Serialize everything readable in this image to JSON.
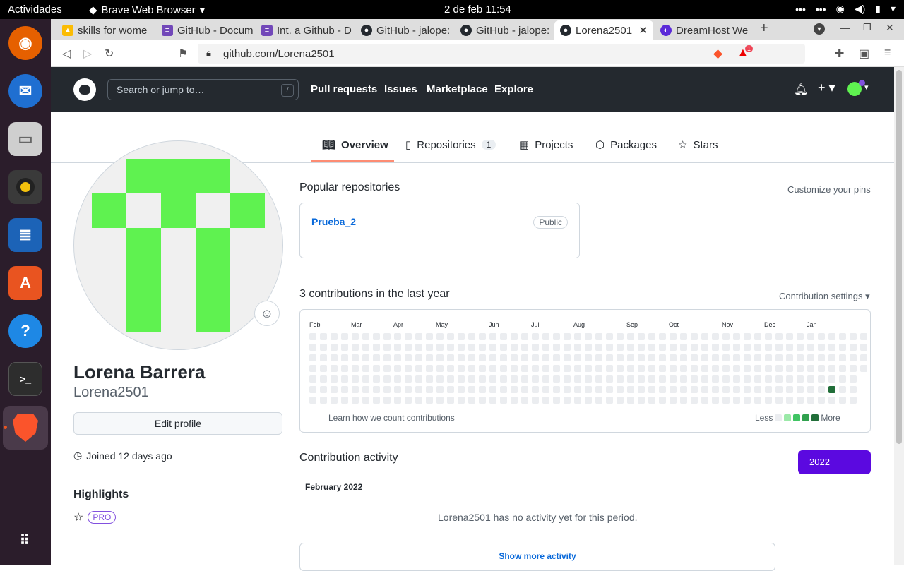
{
  "os": {
    "activities": "Actividades",
    "app_name": "Brave Web Browser",
    "clock": "2 de feb  11:54"
  },
  "browser": {
    "tabs": [
      {
        "label": "skills for wome",
        "favicon": "drive-icon"
      },
      {
        "label": "GitHub - Docum",
        "favicon": "doc-icon"
      },
      {
        "label": "Int. a Github - D",
        "favicon": "doc-icon"
      },
      {
        "label": "GitHub - jalope:",
        "favicon": "github-icon"
      },
      {
        "label": "GitHub - jalope:",
        "favicon": "github-icon"
      },
      {
        "label": "Lorena2501",
        "favicon": "github-icon"
      },
      {
        "label": "DreamHost We",
        "favicon": "dreamhost-icon"
      }
    ],
    "url": "github.com/Lorena2501",
    "rewards_count": "1"
  },
  "github": {
    "search_placeholder": "Search or jump to…",
    "search_key": "/",
    "nav": [
      "Pull requests",
      "Issues",
      "Marketplace",
      "Explore"
    ],
    "profile_tabs": {
      "overview": "Overview",
      "repositories": "Repositories",
      "repositories_count": "1",
      "projects": "Projects",
      "packages": "Packages",
      "stars": "Stars"
    },
    "profile": {
      "full_name": "Lorena Barrera",
      "username": "Lorena2501",
      "edit_profile": "Edit profile",
      "joined": "Joined 12 days ago",
      "highlights": "Highlights",
      "pro_badge": "PRO"
    },
    "popular": {
      "title": "Popular repositories",
      "customize": "Customize your pins",
      "repo_name": "Prueba_2",
      "repo_visibility": "Public"
    },
    "contributions": {
      "title": "3 contributions in the last year",
      "settings": "Contribution settings",
      "months": [
        "Feb",
        "Mar",
        "Apr",
        "May",
        "Jun",
        "Jul",
        "Aug",
        "Sep",
        "Oct",
        "Nov",
        "Dec",
        "Jan"
      ],
      "learn": "Learn how we count contributions",
      "less": "Less",
      "more": "More",
      "colors": [
        "#ebedf0",
        "#9be9a8",
        "#40c463",
        "#30a14e",
        "#216e39"
      ]
    },
    "activity": {
      "title": "Contribution activity",
      "year": "2022",
      "month": "February 2022",
      "empty": "Lorena2501 has no activity yet for this period.",
      "show_more": "Show more activity"
    }
  }
}
